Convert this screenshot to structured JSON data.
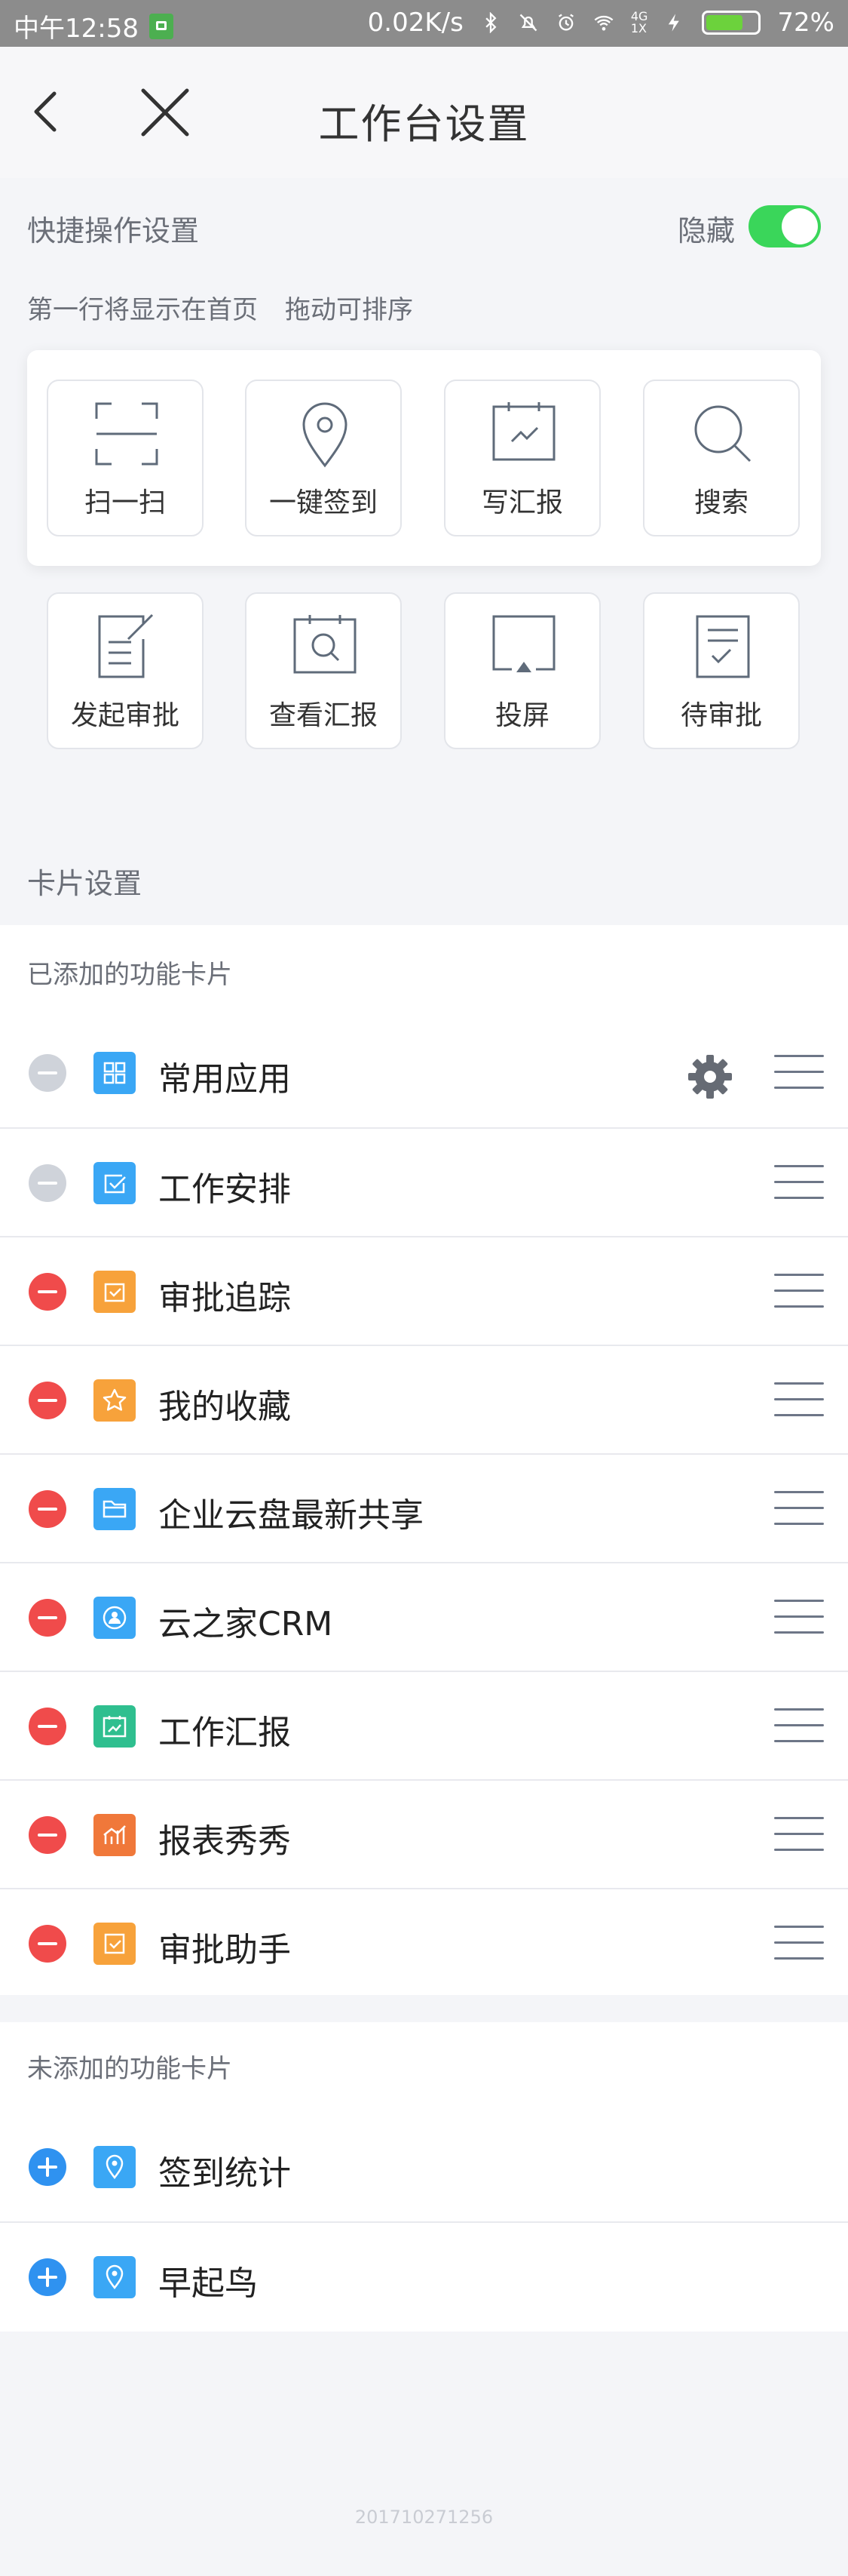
{
  "status_bar": {
    "time": "中午12:58",
    "net_speed": "0.02K/s",
    "signal": "4G",
    "sim": "1X",
    "battery": "72%",
    "battery_level": 0.72,
    "icons": [
      "lock-icon",
      "bluetooth-icon",
      "mute-icon",
      "alarm-icon",
      "wifi-icon",
      "signal-icon",
      "charging-icon",
      "battery-icon"
    ]
  },
  "nav": {
    "title": "工作台设置",
    "back_icon": "chevron-left-icon",
    "close_icon": "close-icon"
  },
  "quick": {
    "header": "快捷操作设置",
    "hide_label": "隐藏",
    "toggle_on": true,
    "hint_first": "第一行将显示在首页",
    "hint_drag": "拖动可排序",
    "tiles": [
      {
        "label": "扫一扫",
        "icon": "scan-icon"
      },
      {
        "label": "一键签到",
        "icon": "location-pin-icon"
      },
      {
        "label": "写汇报",
        "icon": "write-report-icon"
      },
      {
        "label": "搜索",
        "icon": "search-icon"
      },
      {
        "label": "发起审批",
        "icon": "start-approval-icon"
      },
      {
        "label": "查看汇报",
        "icon": "view-report-icon"
      },
      {
        "label": "投屏",
        "icon": "cast-screen-icon"
      },
      {
        "label": "待审批",
        "icon": "pending-approval-icon"
      }
    ]
  },
  "cards": {
    "section_title": "卡片设置",
    "added_title": "已添加的功能卡片",
    "added": [
      {
        "label": "常用应用",
        "icon": "grid-apps-icon",
        "color": "#3aa7f5",
        "removable": false,
        "settings": true
      },
      {
        "label": "工作安排",
        "icon": "task-check-icon",
        "color": "#3aa7f5",
        "removable": false
      },
      {
        "label": "审批追踪",
        "icon": "approval-track-icon",
        "color": "#f7a23b",
        "removable": true
      },
      {
        "label": "我的收藏",
        "icon": "star-icon",
        "color": "#f7a23b",
        "removable": true
      },
      {
        "label": "企业云盘最新共享",
        "icon": "folder-icon",
        "color": "#3aa7f5",
        "removable": true
      },
      {
        "label": "云之家CRM",
        "icon": "crm-icon",
        "color": "#3aa7f5",
        "removable": true
      },
      {
        "label": "工作汇报",
        "icon": "work-report-icon",
        "color": "#2fbf8f",
        "removable": true
      },
      {
        "label": "报表秀秀",
        "icon": "chart-report-icon",
        "color": "#f0783a",
        "removable": true
      },
      {
        "label": "审批助手",
        "icon": "approval-assistant-icon",
        "color": "#f7a23b",
        "removable": true
      }
    ],
    "not_added_title": "未添加的功能卡片",
    "not_added": [
      {
        "label": "签到统计",
        "icon": "location-pin-icon",
        "color": "#3aa7f5"
      },
      {
        "label": "早起鸟",
        "icon": "location-pin-icon",
        "color": "#3aa7f5"
      }
    ]
  },
  "footer": {
    "build": "201710271256"
  }
}
